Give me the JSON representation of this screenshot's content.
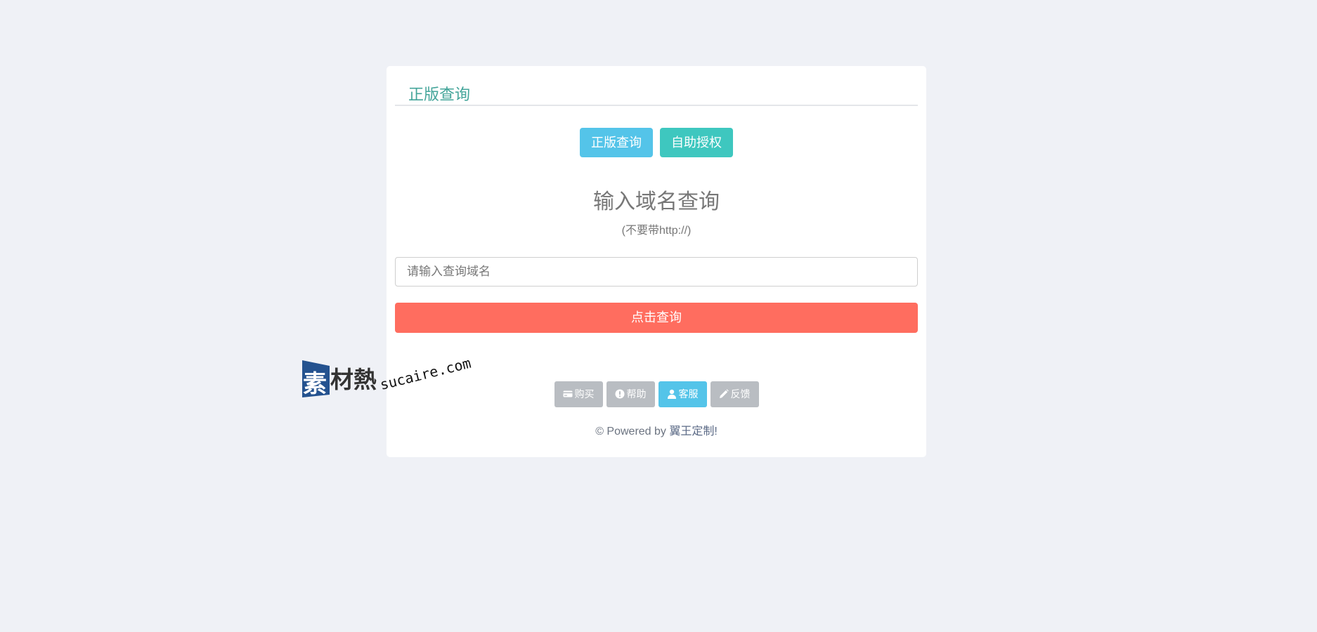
{
  "card": {
    "title": "正版查询"
  },
  "tabs": [
    {
      "label": "正版查询",
      "color": "#54c4e9"
    },
    {
      "label": "自助授权",
      "color": "#3ec7bf"
    }
  ],
  "query": {
    "heading": "输入域名查询",
    "subheading": "(不要带http://)",
    "input_placeholder": "请输入查询域名",
    "input_value": "",
    "submit_label": "点击查询",
    "submit_color": "#ff6d5f"
  },
  "footer_buttons": [
    {
      "label": "购买",
      "icon": "credit-card-icon"
    },
    {
      "label": "帮助",
      "icon": "exclamation-circle-icon"
    },
    {
      "label": "客服",
      "icon": "user-icon",
      "active": true
    },
    {
      "label": "反馈",
      "icon": "pencil-icon"
    }
  ],
  "powered": {
    "prefix": "© Powered by ",
    "brand": "翼王定制!"
  },
  "watermark": {
    "logo_text": "素材熱",
    "domain_text": "sucaire.com"
  },
  "colors": {
    "background": "#eff1f6",
    "title_accent": "#44a59a",
    "footer_button_gray": "#b9bdc2"
  }
}
